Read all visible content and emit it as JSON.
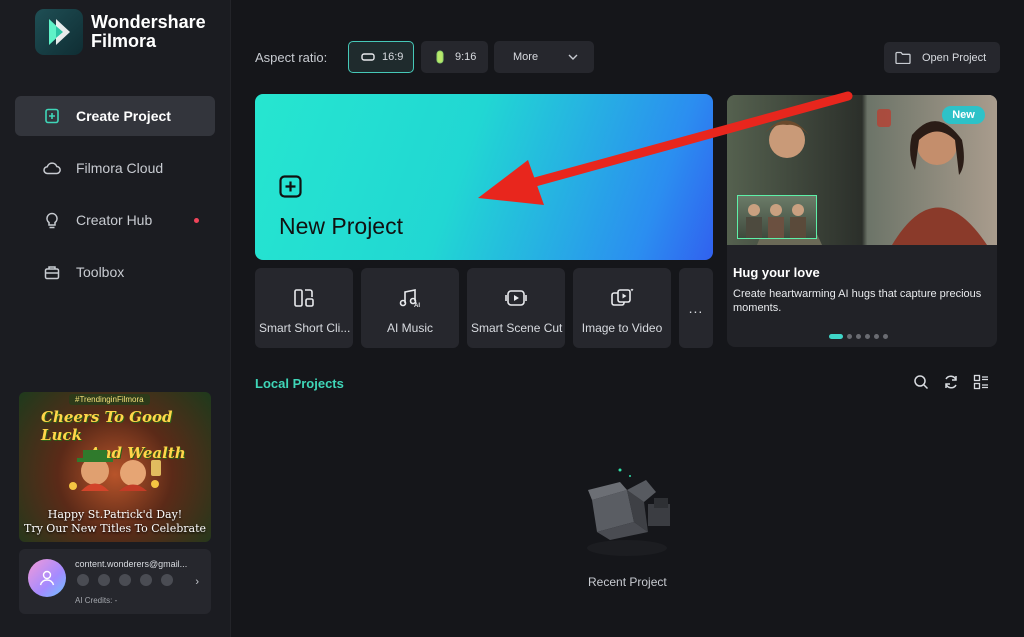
{
  "app": {
    "brand_line1": "Wondershare",
    "brand_line2": "Filmora",
    "accent": "#3fd6b8"
  },
  "sidebar": {
    "items": [
      {
        "label": "Create Project",
        "icon": "create-project-icon",
        "active": true
      },
      {
        "label": "Filmora Cloud",
        "icon": "cloud-icon",
        "active": false
      },
      {
        "label": "Creator Hub",
        "icon": "lightbulb-icon",
        "active": false,
        "notification_dot": true
      },
      {
        "label": "Toolbox",
        "icon": "toolbox-icon",
        "active": false
      }
    ],
    "promo": {
      "tag": "#TrendinginFilmora",
      "headline_line1": "Cheers To Good Luck",
      "headline_line2": "And Wealth",
      "footer_line1": "Happy St.Patrick'd Day!",
      "footer_line2": "Try Our New Titles To Celebrate"
    },
    "account": {
      "email": "content.wonderers@gmail...",
      "credits": "AI Credits: -"
    }
  },
  "topbar": {
    "aspect_label": "Aspect ratio:",
    "ratio_169": "16:9",
    "ratio_916": "9:16",
    "more": "More",
    "open_project": "Open Project"
  },
  "new_project": {
    "title": "New Project"
  },
  "tools": [
    {
      "label": "Smart Short Cli...",
      "icon": "smart-short-clips-icon"
    },
    {
      "label": "AI Music",
      "icon": "ai-music-icon"
    },
    {
      "label": "Smart Scene Cut",
      "icon": "scene-cut-icon"
    },
    {
      "label": "Image to Video",
      "icon": "image-to-video-icon"
    }
  ],
  "more_tools": "...",
  "feature": {
    "badge": "New",
    "title": "Hug your love",
    "description": "Create heartwarming AI hugs that capture precious moments.",
    "slide_count": 6,
    "active_slide": 1
  },
  "local_projects": {
    "title": "Local Projects",
    "empty_label": "Recent Project"
  }
}
